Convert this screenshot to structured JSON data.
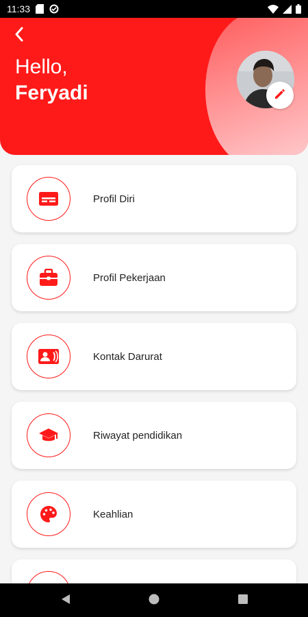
{
  "status_bar": {
    "time": "11:33",
    "icons_left": [
      "sd-card-icon",
      "sync-icon"
    ],
    "icons_right": [
      "wifi-icon",
      "signal-icon",
      "battery-icon"
    ]
  },
  "header": {
    "greeting": "Hello,",
    "name": "Feryadi",
    "accent_color": "#ff1a1a"
  },
  "menu": {
    "items": [
      {
        "label": "Profil Diri",
        "icon": "id-card-icon"
      },
      {
        "label": "Profil Pekerjaan",
        "icon": "briefcase-icon"
      },
      {
        "label": "Kontak Darurat",
        "icon": "contact-phone-icon"
      },
      {
        "label": "Riwayat pendidikan",
        "icon": "graduation-cap-icon"
      },
      {
        "label": "Keahlian",
        "icon": "palette-icon"
      },
      {
        "label": "",
        "icon": "unknown-icon"
      }
    ]
  },
  "nav_bar": {
    "buttons": [
      "back-triangle-icon",
      "home-circle-icon",
      "recents-square-icon"
    ]
  }
}
